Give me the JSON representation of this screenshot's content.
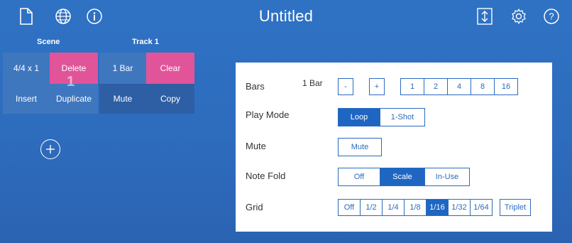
{
  "header": {
    "title": "Untitled",
    "left_icons": [
      "file-icon",
      "globe-icon",
      "info-icon"
    ],
    "right_icons": [
      "resize-icon",
      "gear-icon",
      "help-icon"
    ]
  },
  "columns": {
    "scene": "Scene",
    "track": "Track 1"
  },
  "scene": {
    "meter": "4/4 x 1",
    "delete": "Delete",
    "number": "1",
    "insert": "Insert",
    "duplicate": "Duplicate"
  },
  "track": {
    "bars": "1 Bar",
    "clear": "Clear",
    "mute": "Mute",
    "copy": "Copy"
  },
  "panel": {
    "bars_label": "Bars",
    "bars_value": "1 Bar",
    "bars_minus": "-",
    "bars_plus": "+",
    "bar_options": [
      "1",
      "2",
      "4",
      "8",
      "16"
    ],
    "play_mode_label": "Play Mode",
    "play_modes": [
      "Loop",
      "1-Shot"
    ],
    "play_mode_selected": "Loop",
    "mute_label": "Mute",
    "mute_button": "Mute",
    "note_fold_label": "Note Fold",
    "note_fold_options": [
      "Off",
      "Scale",
      "In-Use"
    ],
    "note_fold_selected": "Scale",
    "grid_label": "Grid",
    "grid_options": [
      "Off",
      "1/2",
      "1/4",
      "1/8",
      "1/16",
      "1/32",
      "1/64"
    ],
    "grid_selected": "1/16",
    "triplet": "Triplet"
  },
  "colors": {
    "background": "#2e6cbd",
    "accent_pink": "#e1549a",
    "button_blue": "#1f66c2"
  }
}
